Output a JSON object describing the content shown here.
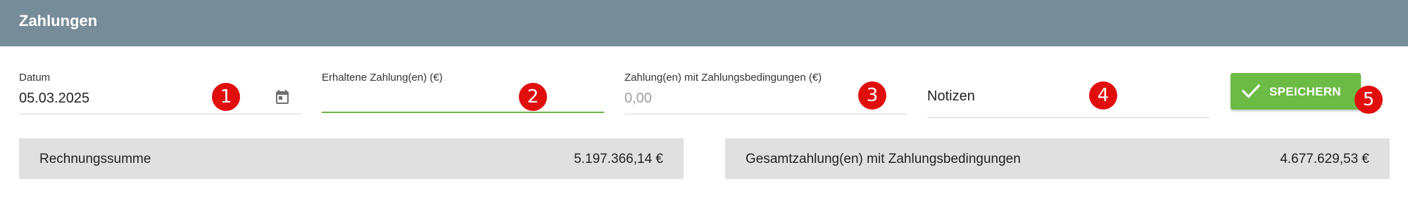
{
  "header": {
    "title": "Zahlungen"
  },
  "fields": {
    "date": {
      "label": "Datum",
      "value": "05.03.2025"
    },
    "received_payment": {
      "label": "Erhaltene Zahlung(en) (€)",
      "value": ""
    },
    "payment_terms": {
      "label": "Zahlung(en) mit Zahlungsbedingungen (€)",
      "placeholder": "0,00"
    },
    "notes": {
      "placeholder": "Notizen"
    }
  },
  "actions": {
    "save_label": "SPEICHERN"
  },
  "markers": [
    "1",
    "2",
    "3",
    "4",
    "5"
  ],
  "summary": {
    "invoice_total": {
      "label": "Rechnungssumme",
      "value": "5.197.366,14 €"
    },
    "total_with_terms": {
      "label": "Gesamtzahlung(en) mit Zahlungsbedingungen",
      "value": "4.677.629,53 €"
    }
  },
  "colors": {
    "header_bg": "#778c99",
    "accent_green": "#6cbb45",
    "marker_red": "#e10e0e",
    "summary_bg": "#e0e0e0"
  },
  "icons": {
    "calendar": "calendar-icon",
    "check": "check-icon"
  }
}
